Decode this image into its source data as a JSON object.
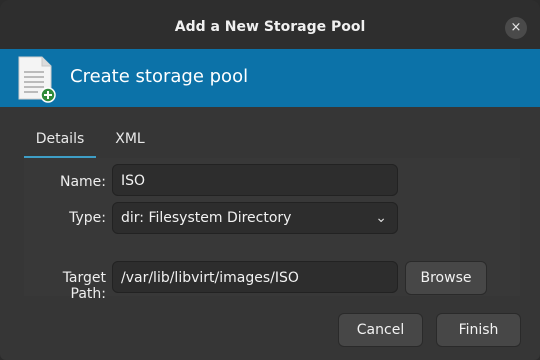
{
  "window": {
    "title": "Add a New Storage Pool",
    "close_glyph": "×"
  },
  "banner": {
    "title": "Create storage pool",
    "icon": "document-add-icon"
  },
  "tabs": [
    {
      "label": "Details",
      "active": true
    },
    {
      "label": "XML",
      "active": false
    }
  ],
  "form": {
    "name_label": "Name:",
    "name_value": "ISO",
    "type_label": "Type:",
    "type_value": "dir: Filesystem Directory",
    "target_label": "Target Path:",
    "target_value": "/var/lib/libvirt/images/ISO",
    "browse_label": "Browse"
  },
  "footer": {
    "cancel_label": "Cancel",
    "finish_label": "Finish"
  },
  "colors": {
    "banner": "#0c72a8",
    "tab_indicator": "#3e9ec6",
    "background": "#363636"
  }
}
